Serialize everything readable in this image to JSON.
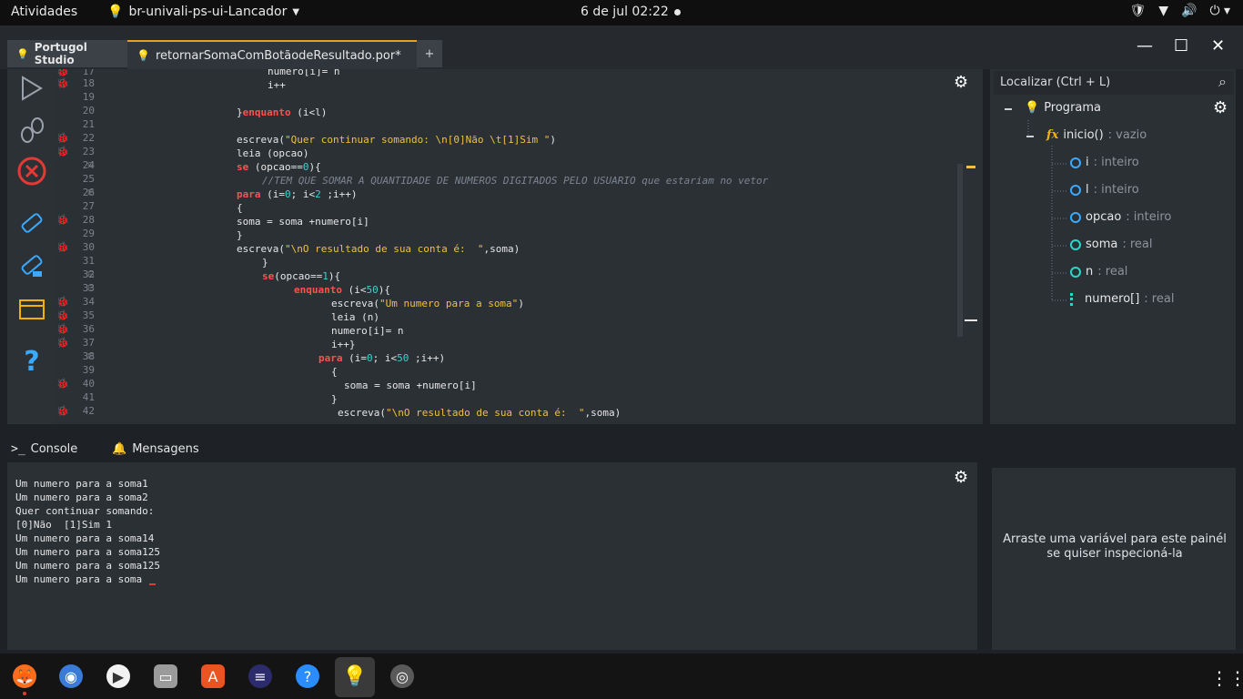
{
  "topbar": {
    "activities": "Atividades",
    "app_name": "br-univali-ps-ui-Lancador",
    "clock": "6 de jul  02:22"
  },
  "tabs": {
    "home_label": "Portugol Studio",
    "file_label": "retornarSomaComBotãodeResultado.por*",
    "add_label": "+"
  },
  "editor": {
    "line_numbers": [
      "17",
      "18",
      "19",
      "20",
      "21",
      "22",
      "23",
      "24",
      "25",
      "26",
      "27",
      "28",
      "29",
      "30",
      "31",
      "32",
      "33",
      "34",
      "35",
      "36",
      "37",
      "38",
      "39",
      "40",
      "41",
      "42"
    ]
  },
  "outline": {
    "search_placeholder": "Localizar (Ctrl + L)",
    "root": "Programa",
    "function": "inicio()",
    "function_type": ": vazio",
    "variables": [
      {
        "name": "i",
        "type": ": inteiro"
      },
      {
        "name": "l",
        "type": ": inteiro"
      },
      {
        "name": "opcao",
        "type": ": inteiro"
      },
      {
        "name": "soma",
        "type": ": real"
      },
      {
        "name": "n",
        "type": ": real"
      },
      {
        "name": "numero[]",
        "type": ": real"
      }
    ]
  },
  "bottom_tabs": {
    "console": "Console",
    "messages": "Mensagens"
  },
  "console": {
    "lines": [
      "Um numero para a soma1",
      "Um numero para a soma2",
      "Quer continuar somando:",
      "[0]Não  [1]Sim 1",
      "Um numero para a soma14",
      "Um numero para a soma125",
      "Um numero para a soma125",
      "Um numero para a soma"
    ]
  },
  "inspector": {
    "hint": "Arraste uma variável para este painél se quiser inspecioná-la"
  },
  "colors": {
    "keyword": "#ff5050",
    "string": "#f0c040",
    "number": "#3fd0d0",
    "accent": "#e8a21a"
  }
}
